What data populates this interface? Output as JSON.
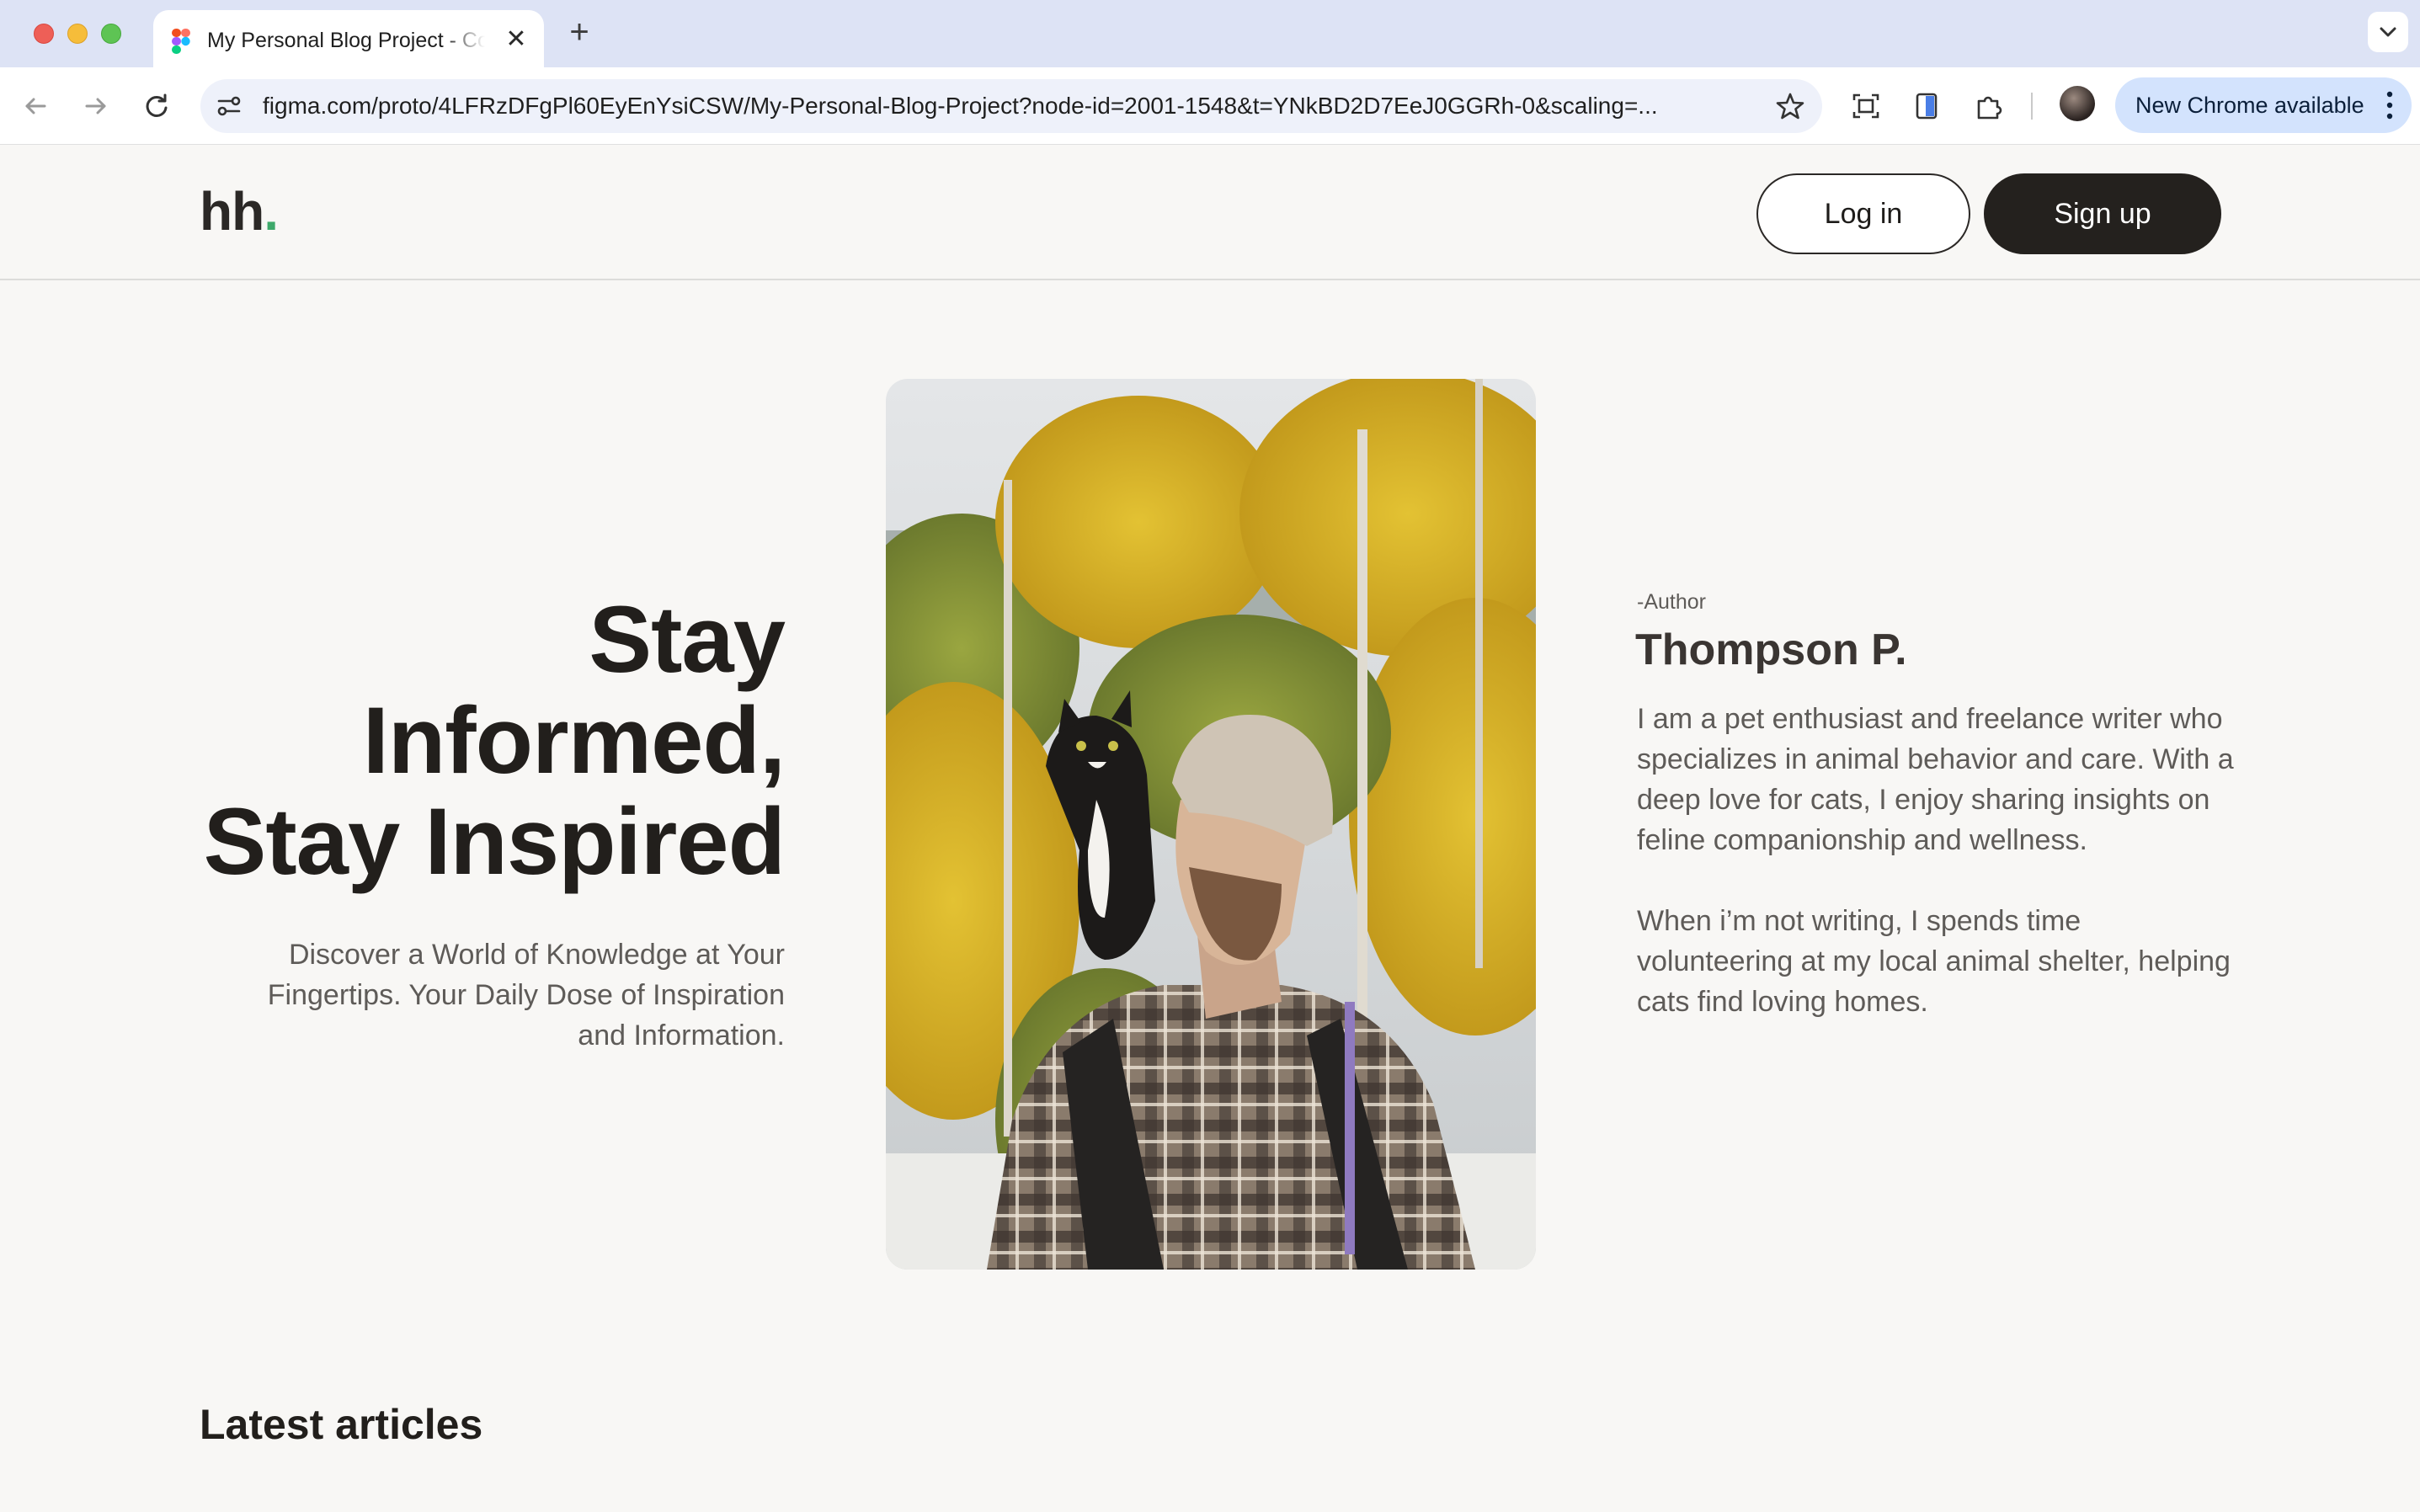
{
  "browser": {
    "tab_title": "My Personal Blog Project - Community",
    "tab_close": "✕",
    "new_tab": "+",
    "url": "figma.com/proto/4LFRzDFgPl60EyEnYsiCSW/My-Personal-Blog-Project?node-id=2001-1548&t=YNkBD2D7EeJ0GGRh-0&scaling=...",
    "update_label": "New Chrome available"
  },
  "header": {
    "logo_text": "hh",
    "logo_dot": ".",
    "login_label": "Log in",
    "signup_label": "Sign up"
  },
  "hero": {
    "title_lines": [
      "Stay",
      "Informed,",
      "Stay Inspired"
    ],
    "subtitle": "Discover a World of Knowledge at Your Fingertips. Your Daily Dose of Inspiration and Information."
  },
  "author": {
    "tag": "-Author",
    "name": "Thompson P.",
    "bio": [
      "I am a pet enthusiast and freelance writer who specializes in animal behavior and care. With a deep love for cats, I enjoy sharing insights on feline companionship and wellness.",
      "When i’m not writing, I spends time volunteering at my local animal shelter, helping cats find loving homes."
    ]
  },
  "sections": {
    "latest_articles": "Latest articles"
  },
  "colors": {
    "accent_dot": "#3ea96b",
    "dark_button": "#24211e",
    "page_background": "#f8f7f5"
  }
}
